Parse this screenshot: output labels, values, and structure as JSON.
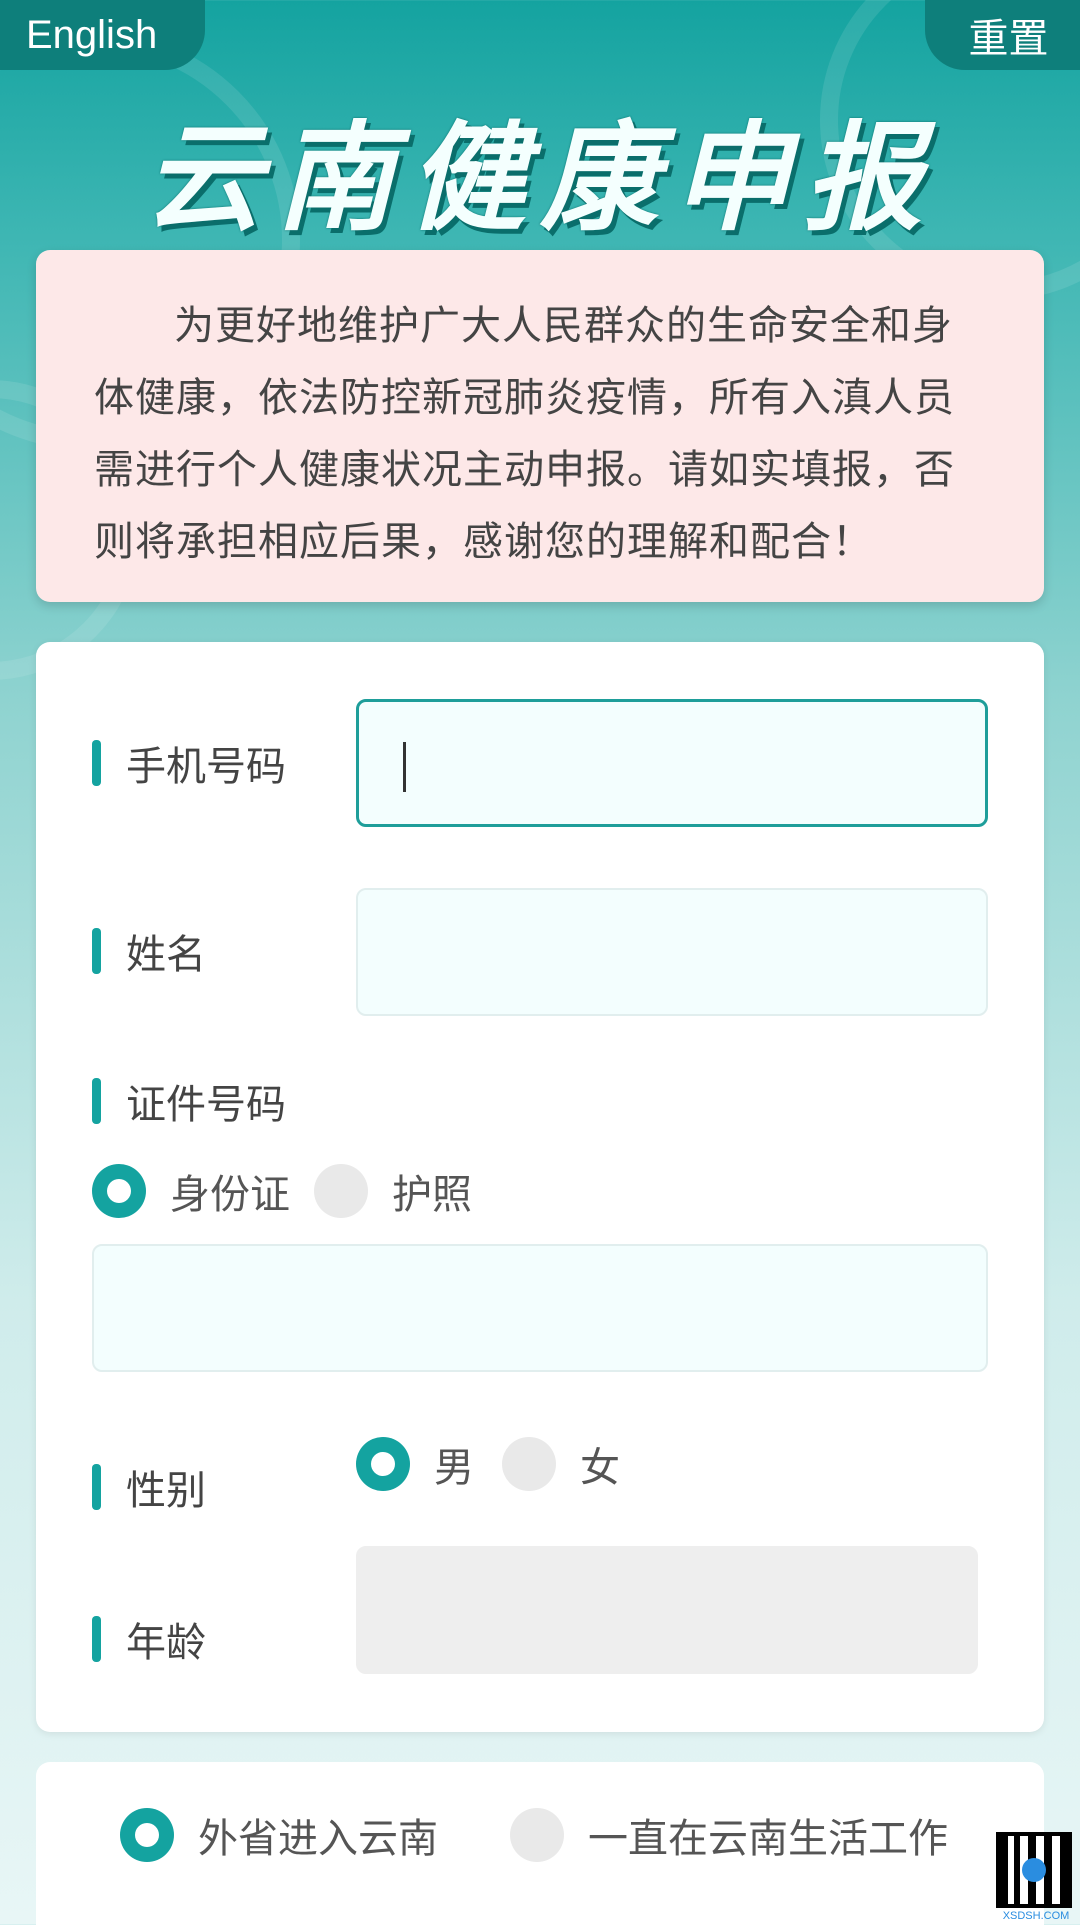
{
  "header": {
    "language_button": "English",
    "reset_button": "重置",
    "title": "云南健康申报"
  },
  "notice": {
    "text": "为更好地维护广大人民群众的生命安全和身体健康，依法防控新冠肺炎疫情，所有入滇人员需进行个人健康状况主动申报。请如实填报，否则将承担相应后果，感谢您的理解和配合！"
  },
  "form": {
    "phone": {
      "label": "手机号码",
      "value": ""
    },
    "name": {
      "label": "姓名",
      "value": ""
    },
    "id_number": {
      "label": "证件号码",
      "options": [
        "身份证",
        "护照"
      ],
      "selected": "身份证",
      "value": ""
    },
    "gender": {
      "label": "性别",
      "options": [
        "男",
        "女"
      ],
      "selected": "男"
    },
    "age": {
      "label": "年龄",
      "value": ""
    }
  },
  "residence": {
    "options": [
      "外省进入云南",
      "一直在云南生活工作"
    ],
    "selected": "外省进入云南"
  },
  "watermark": {
    "text": "XSDSH.COM"
  },
  "colors": {
    "accent": "#14a3a0",
    "notice_bg": "#fde8e8",
    "input_bg": "#f3fefe"
  }
}
